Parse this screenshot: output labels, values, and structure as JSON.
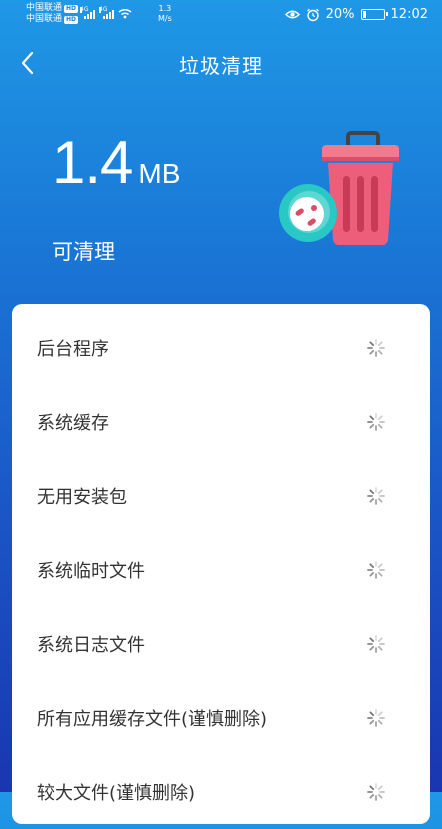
{
  "status_bar": {
    "carrier_1": "中国联通",
    "carrier_2": "中国联通",
    "hd_badge": "HD",
    "network_1": "4G",
    "network_2": "4G",
    "speed_value": "1.3",
    "speed_unit": "M/s",
    "battery_percent": "20%",
    "battery_level": 0.2,
    "time": "12:02",
    "icons": [
      "eye-icon",
      "alarm-icon",
      "battery-icon"
    ]
  },
  "header": {
    "title": "垃圾清理",
    "back_icon": "chevron-left-icon"
  },
  "summary": {
    "size_value": "1.4",
    "size_unit": "MB",
    "label": "可清理"
  },
  "colors": {
    "gradient_top": "#1f98e6",
    "gradient_bottom": "#1936b0",
    "trash_pink": "#ec5e79",
    "bubble_teal": "#29c8c4"
  },
  "scan_list": [
    {
      "label": "后台程序"
    },
    {
      "label": "系统缓存"
    },
    {
      "label": "无用安装包"
    },
    {
      "label": "系统临时文件"
    },
    {
      "label": "系统日志文件"
    },
    {
      "label": "所有应用缓存文件(谨慎删除)"
    },
    {
      "label": "较大文件(谨慎删除)"
    }
  ]
}
